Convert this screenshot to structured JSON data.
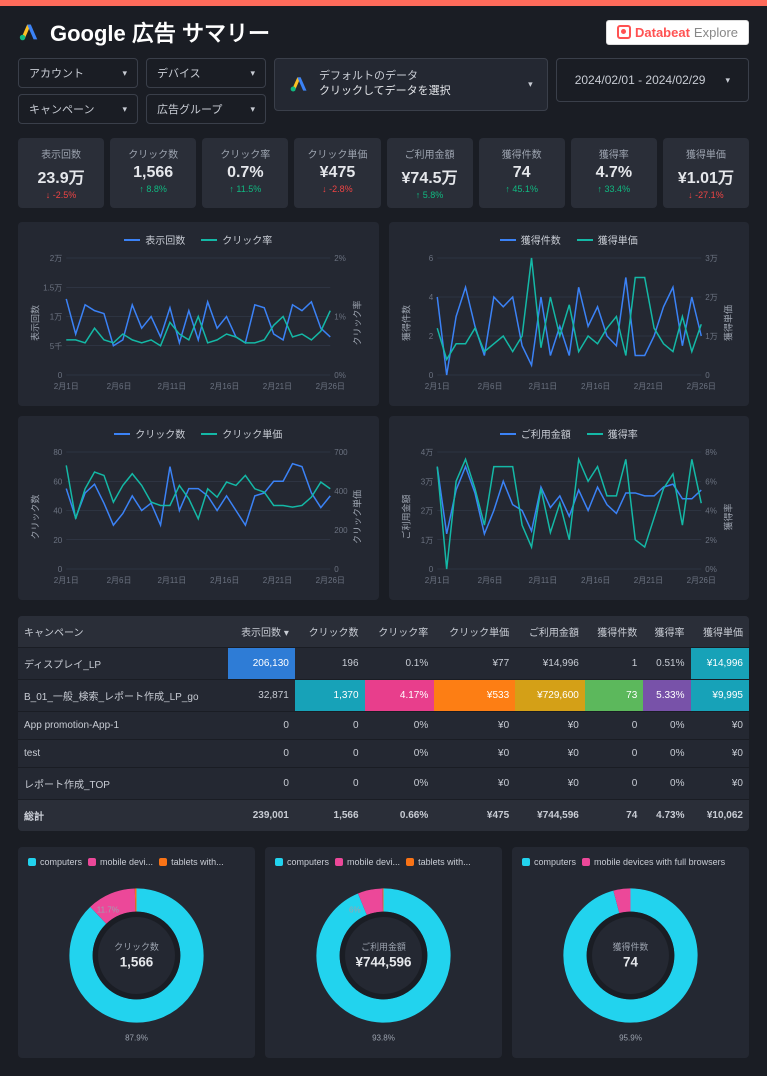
{
  "title": "Google 広告 サマリー",
  "brand": {
    "name1": "Databeat",
    "name2": "Explore"
  },
  "filters": {
    "account": "アカウント",
    "device": "デバイス",
    "campaign": "キャンペーン",
    "adgroup": "広告グループ",
    "data_default": "デフォルトのデータ",
    "data_hint": "クリックしてデータを選択",
    "date_range": "2024/02/01 - 2024/02/29"
  },
  "kpis": [
    {
      "label": "表示回数",
      "value": "23.9万",
      "delta": "-2.5%",
      "dir": "dn"
    },
    {
      "label": "クリック数",
      "value": "1,566",
      "delta": "8.8%",
      "dir": "up"
    },
    {
      "label": "クリック率",
      "value": "0.7%",
      "delta": "11.5%",
      "dir": "up"
    },
    {
      "label": "クリック単価",
      "value": "¥475",
      "delta": "-2.8%",
      "dir": "dn"
    },
    {
      "label": "ご利用金額",
      "value": "¥74.5万",
      "delta": "5.8%",
      "dir": "up"
    },
    {
      "label": "獲得件数",
      "value": "74",
      "delta": "45.1%",
      "dir": "up"
    },
    {
      "label": "獲得率",
      "value": "4.7%",
      "delta": "33.4%",
      "dir": "up"
    },
    {
      "label": "獲得単価",
      "value": "¥1.01万",
      "delta": "-27.1%",
      "dir": "dn"
    }
  ],
  "chart_data": [
    {
      "type": "line",
      "title": "",
      "xlabel": "",
      "x_ticks": [
        "2月1日",
        "2月6日",
        "2月11日",
        "2月16日",
        "2月21日",
        "2月26日"
      ],
      "series": [
        {
          "name": "表示回数",
          "color": "#3b82f6",
          "axis": "left",
          "values": [
            13000,
            7000,
            12000,
            11000,
            10500,
            5000,
            6000,
            12000,
            8000,
            10000,
            6500,
            11500,
            5500,
            11000,
            6000,
            12500,
            8000,
            10000,
            6500,
            5500,
            12000,
            11500,
            7000,
            6000,
            12000,
            11000,
            12500,
            8000,
            6500
          ]
        },
        {
          "name": "クリック率",
          "color": "#14b8a6",
          "axis": "right",
          "values": [
            0.6,
            0.6,
            0.55,
            0.8,
            0.6,
            0.55,
            0.7,
            0.6,
            0.55,
            0.6,
            0.5,
            0.9,
            0.7,
            0.6,
            1.0,
            0.55,
            0.6,
            0.7,
            0.65,
            0.55,
            0.55,
            0.6,
            0.85,
            1.0,
            0.65,
            0.7,
            0.6,
            0.75,
            1.1
          ]
        }
      ],
      "y_left": {
        "label": "表示回数",
        "min": 0,
        "max": 20000,
        "ticks": [
          "0",
          "5千",
          "1万",
          "1.5万",
          "2万"
        ]
      },
      "y_right": {
        "label": "クリック率",
        "min": 0,
        "max": 2,
        "ticks": [
          "0%",
          "1%",
          "2%"
        ]
      }
    },
    {
      "type": "line",
      "x_ticks": [
        "2月1日",
        "2月6日",
        "2月11日",
        "2月16日",
        "2月21日",
        "2月26日"
      ],
      "series": [
        {
          "name": "獲得件数",
          "color": "#3b82f6",
          "axis": "left",
          "values": [
            4,
            0,
            3,
            4.5,
            2.5,
            1,
            4,
            3.5,
            4,
            1.5,
            0.5,
            4,
            1,
            2.5,
            1,
            4.5,
            2.5,
            3.5,
            2,
            1.5,
            5,
            1,
            1,
            2,
            3.5,
            4.5,
            1.5,
            4,
            2
          ]
        },
        {
          "name": "獲得単価",
          "color": "#14b8a6",
          "axis": "right",
          "values": [
            12000,
            4000,
            8000,
            8000,
            12000,
            6000,
            8000,
            10000,
            6000,
            10000,
            30000,
            7000,
            20000,
            10000,
            18000,
            6000,
            10000,
            8000,
            12000,
            15000,
            5000,
            25000,
            25000,
            12000,
            8000,
            6000,
            15000,
            6000,
            13000
          ]
        }
      ],
      "y_left": {
        "label": "獲得件数",
        "min": 0,
        "max": 6,
        "ticks": [
          "0",
          "2",
          "4",
          "6"
        ]
      },
      "y_right": {
        "label": "獲得単価",
        "min": 0,
        "max": 30000,
        "ticks": [
          "0",
          "1万",
          "2万",
          "3万"
        ]
      }
    },
    {
      "type": "line",
      "x_ticks": [
        "2月1日",
        "2月6日",
        "2月11日",
        "2月16日",
        "2月21日",
        "2月26日"
      ],
      "series": [
        {
          "name": "クリック数",
          "color": "#3b82f6",
          "axis": "left",
          "values": [
            55,
            35,
            52,
            58,
            45,
            30,
            38,
            50,
            40,
            45,
            30,
            70,
            40,
            55,
            55,
            50,
            40,
            50,
            40,
            30,
            50,
            52,
            60,
            60,
            72,
            70,
            52,
            42,
            50
          ]
        },
        {
          "name": "クリック単価",
          "color": "#14b8a6",
          "axis": "right",
          "values": [
            620,
            300,
            480,
            580,
            560,
            400,
            500,
            570,
            500,
            400,
            380,
            380,
            500,
            420,
            300,
            480,
            430,
            520,
            500,
            560,
            480,
            460,
            380,
            380,
            370,
            380,
            430,
            520,
            480
          ]
        }
      ],
      "y_left": {
        "label": "クリック数",
        "min": 0,
        "max": 80,
        "ticks": [
          "0",
          "20",
          "40",
          "60",
          "80"
        ]
      },
      "y_right": {
        "label": "クリック単価",
        "min": 0,
        "max": 700,
        "ticks": [
          "0",
          "200",
          "400",
          "700"
        ]
      }
    },
    {
      "type": "line",
      "x_ticks": [
        "2月1日",
        "2月6日",
        "2月11日",
        "2月16日",
        "2月21日",
        "2月26日"
      ],
      "series": [
        {
          "name": "ご利用金額",
          "color": "#3b82f6",
          "axis": "left",
          "values": [
            35000,
            12000,
            27000,
            35000,
            26000,
            12000,
            20000,
            30000,
            22000,
            20000,
            13000,
            28000,
            21000,
            25000,
            18000,
            27000,
            20000,
            28000,
            22000,
            19000,
            26000,
            26000,
            25000,
            25000,
            28000,
            29000,
            24000,
            24000,
            27000
          ]
        },
        {
          "name": "獲得率",
          "color": "#14b8a6",
          "axis": "right",
          "values": [
            7,
            0,
            6,
            7.5,
            5.5,
            3,
            7,
            7,
            7,
            3,
            1.5,
            5.5,
            2.5,
            4.5,
            2,
            7.5,
            6,
            7,
            5,
            5,
            7.5,
            2,
            1.5,
            3.5,
            5.5,
            6.5,
            3,
            7.5,
            4.5
          ]
        }
      ],
      "y_left": {
        "label": "ご利用金額",
        "min": 0,
        "max": 40000,
        "ticks": [
          "0",
          "1万",
          "2万",
          "3万",
          "4万"
        ]
      },
      "y_right": {
        "label": "獲得率",
        "min": 0,
        "max": 8,
        "ticks": [
          "0%",
          "2%",
          "4%",
          "6%",
          "8%"
        ]
      }
    }
  ],
  "table": {
    "headers": [
      "キャンペーン",
      "表示回数 ▾",
      "クリック数",
      "クリック率",
      "クリック単価",
      "ご利用金額",
      "獲得件数",
      "獲得率",
      "獲得単価"
    ],
    "rows": [
      {
        "cells": [
          "ディスプレイ_LP",
          "206,130",
          "196",
          "0.1%",
          "¥77",
          "¥14,996",
          "1",
          "0.51%",
          "¥14,996"
        ],
        "hl": [
          null,
          "blue",
          null,
          null,
          null,
          null,
          null,
          null,
          "cyan"
        ]
      },
      {
        "cells": [
          "B_01_一般_検索_レポート作成_LP_go",
          "32,871",
          "1,370",
          "4.17%",
          "¥533",
          "¥729,600",
          "73",
          "5.33%",
          "¥9,995"
        ],
        "hl": [
          null,
          null,
          "cyan",
          "mag",
          "org",
          "yel",
          "grn",
          "pur",
          "cyan"
        ]
      },
      {
        "cells": [
          "App promotion-App-1",
          "0",
          "0",
          "0%",
          "¥0",
          "¥0",
          "0",
          "0%",
          "¥0"
        ],
        "hl": []
      },
      {
        "cells": [
          "test",
          "0",
          "0",
          "0%",
          "¥0",
          "¥0",
          "0",
          "0%",
          "¥0"
        ],
        "hl": []
      },
      {
        "cells": [
          "レポート作成_TOP",
          "0",
          "0",
          "0%",
          "¥0",
          "¥0",
          "0",
          "0%",
          "¥0"
        ],
        "hl": []
      }
    ],
    "total": [
      "総計",
      "239,001",
      "1,566",
      "0.66%",
      "¥475",
      "¥744,596",
      "74",
      "4.73%",
      "¥10,062"
    ]
  },
  "donuts": [
    {
      "label": "クリック数",
      "value": "1,566",
      "legend": [
        "computers",
        "mobile devi...",
        "tablets with..."
      ],
      "segments": [
        {
          "pct": 87.9,
          "color": "#22d3ee"
        },
        {
          "pct": 11.7,
          "color": "#ec4899"
        },
        {
          "pct": 0.4,
          "color": "#f97316"
        }
      ],
      "main_pct": "87.9%",
      "sec_pct": "11.7%"
    },
    {
      "label": "ご利用金額",
      "value": "¥744,596",
      "legend": [
        "computers",
        "mobile devi...",
        "tablets with..."
      ],
      "segments": [
        {
          "pct": 93.8,
          "color": "#22d3ee"
        },
        {
          "pct": 6.0,
          "color": "#ec4899"
        },
        {
          "pct": 0.2,
          "color": "#f97316"
        }
      ],
      "main_pct": "93.8%",
      "sec_pct": "6%"
    },
    {
      "label": "獲得件数",
      "value": "74",
      "legend": [
        "computers",
        "mobile devices with full browsers"
      ],
      "segments": [
        {
          "pct": 95.9,
          "color": "#22d3ee"
        },
        {
          "pct": 4.1,
          "color": "#ec4899"
        }
      ],
      "main_pct": "95.9%",
      "sec_pct": ""
    }
  ],
  "colors": {
    "cyan": "#22d3ee",
    "mag": "#ec4899",
    "org": "#f97316"
  }
}
